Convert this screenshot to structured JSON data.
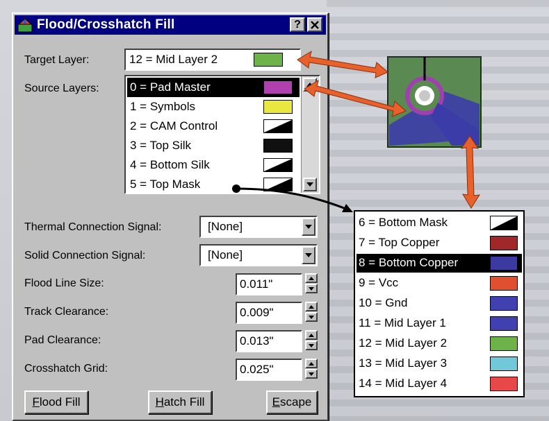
{
  "window": {
    "title": "Flood/Crosshatch Fill",
    "help_label": "?",
    "close_label": "✕"
  },
  "target": {
    "label": "Target Layer:",
    "value": "12 = Mid Layer 2",
    "color": "#6db34a"
  },
  "source": {
    "label": "Source Layers:",
    "items": [
      {
        "label": "0 = Pad Master",
        "color": "#b040b0",
        "selected": true
      },
      {
        "label": "1 = Symbols",
        "color": "#e8e840",
        "selected": false
      },
      {
        "label": "2 = CAM Control",
        "color": "diag",
        "selected": false
      },
      {
        "label": "3 = Top Silk",
        "color": "#101010",
        "selected": false
      },
      {
        "label": "4 = Bottom Silk",
        "color": "diag",
        "selected": false
      },
      {
        "label": "5 = Top Mask",
        "color": "diag",
        "selected": false
      }
    ]
  },
  "fields": {
    "thermal_label": "Thermal Connection Signal:",
    "thermal_value": "[None]",
    "solid_label": "Solid Connection Signal:",
    "solid_value": "[None]",
    "flood_label": "Flood Line Size:",
    "flood_value": "0.011\"",
    "track_label": "Track Clearance:",
    "track_value": "0.009\"",
    "pad_label": "Pad Clearance:",
    "pad_value": "0.013\"",
    "grid_label": "Crosshatch Grid:",
    "grid_value": "0.025\""
  },
  "buttons": {
    "flood_first": "F",
    "flood_rest": "lood Fill",
    "hatch_first": "H",
    "hatch_rest": "atch Fill",
    "escape_first": "E",
    "escape_rest": "scape"
  },
  "popup": {
    "items": [
      {
        "label": "6 = Bottom Mask",
        "color": "diag",
        "selected": false
      },
      {
        "label": "7 = Top Copper",
        "color": "#a02828",
        "selected": false
      },
      {
        "label": "8 = Bottom Copper",
        "color": "#3a3aa0",
        "selected": true
      },
      {
        "label": "9 = Vcc",
        "color": "#e05030",
        "selected": false
      },
      {
        "label": "10 = Gnd",
        "color": "#4040b0",
        "selected": false
      },
      {
        "label": "11 = Mid Layer 1",
        "color": "#4040b0",
        "selected": false
      },
      {
        "label": "12 = Mid Layer 2",
        "color": "#6db34a",
        "selected": false
      },
      {
        "label": "13 = Mid Layer 3",
        "color": "#70c8d8",
        "selected": false
      },
      {
        "label": "14 = Mid Layer 4",
        "color": "#e84848",
        "selected": false
      }
    ]
  },
  "colors": {
    "title_bar": "#000080",
    "dialog_face": "#c0c0c0",
    "arrow_orange": "#e8602a",
    "board_green": "#5a8a52",
    "pad_purple": "#a040b0"
  }
}
